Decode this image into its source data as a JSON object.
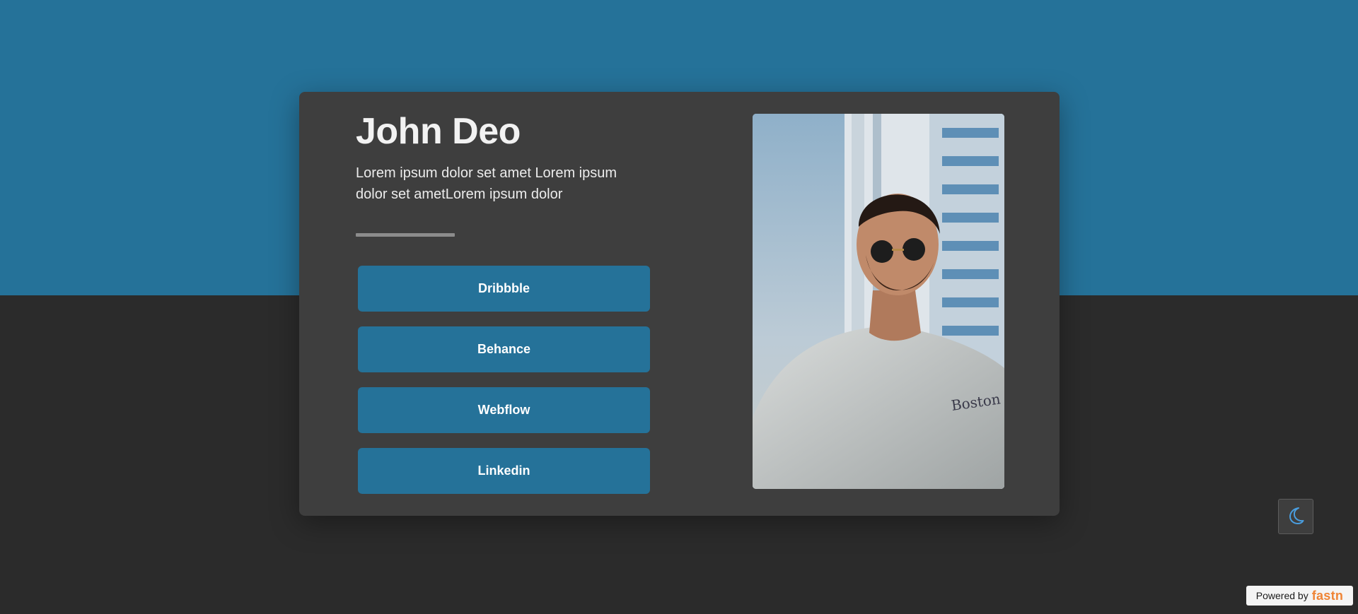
{
  "profile": {
    "name": "John Deo",
    "bio": "Lorem ipsum dolor set amet Lorem ipsum dolor set ametLorem ipsum dolor"
  },
  "links": [
    {
      "label": "Dribbble"
    },
    {
      "label": "Behance"
    },
    {
      "label": "Webflow"
    },
    {
      "label": "Linkedin"
    }
  ],
  "theme_toggle": {
    "icon": "moon-icon"
  },
  "footer": {
    "powered_label": "Powered by",
    "brand": "fastn"
  },
  "colors": {
    "accent": "#257299",
    "background": "#2b2b2b",
    "card": "#3e3e3e",
    "brand": "#ef8435"
  }
}
